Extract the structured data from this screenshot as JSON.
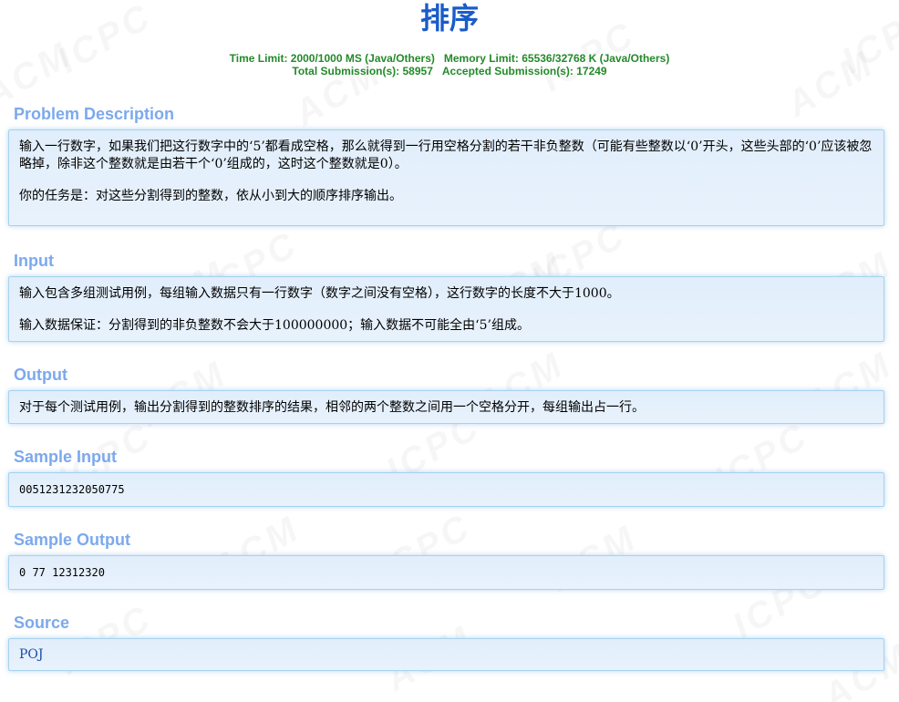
{
  "problem": {
    "title": "排序",
    "time_limit": "Time Limit: 2000/1000 MS (Java/Others)",
    "memory_limit": "Memory Limit: 65536/32768 K (Java/Others)",
    "total_submissions": "Total Submission(s): 58957",
    "accepted_submissions": "Accepted Submission(s): 17249"
  },
  "sections": {
    "description": {
      "title": "Problem Description",
      "p1": "输入一行数字，如果我们把这行数字中的‘5’都看成空格，那么就得到一行用空格分割的若干非负整数（可能有些整数以‘0’开头，这些头部的‘0’应该被忽略掉，除非这个整数就是由若干个‘0’组成的，这时这个整数就是0）。",
      "p2": "你的任务是：对这些分割得到的整数，依从小到大的顺序排序输出。"
    },
    "input": {
      "title": "Input",
      "p1": "输入包含多组测试用例，每组输入数据只有一行数字（数字之间没有空格），这行数字的长度不大于1000。",
      "p2": "输入数据保证：分割得到的非负整数不会大于100000000；输入数据不可能全由‘5’组成。"
    },
    "output": {
      "title": "Output",
      "p1": "对于每个测试用例，输出分割得到的整数排序的结果，相邻的两个整数之间用一个空格分开，每组输出占一行。"
    },
    "sample_input": {
      "title": "Sample Input",
      "text": "0051231232050775"
    },
    "sample_output": {
      "title": "Sample Output",
      "text": "0 77 12312320"
    },
    "source": {
      "title": "Source",
      "link": "POJ"
    }
  },
  "watermark": {
    "acm": "ACM",
    "icpc": "ICPC"
  },
  "colors": {
    "title": "#1a5cc8",
    "limits": "#238a2a",
    "section_title": "#7ca9ed",
    "panel_border": "#a6d2ef",
    "panel_bg": "#e1eefb"
  }
}
